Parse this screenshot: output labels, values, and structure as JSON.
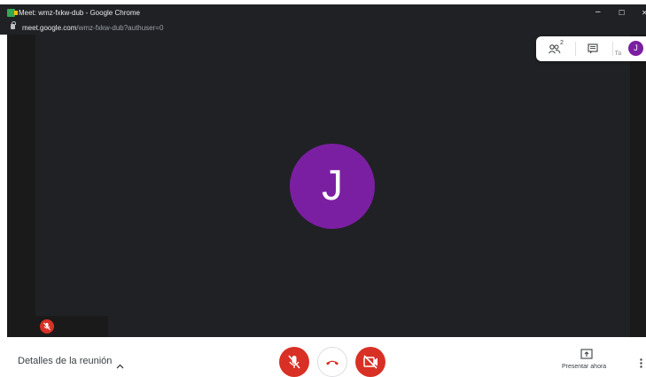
{
  "window": {
    "title": "Meet: wmz-fxkw-dub - Google Chrome",
    "minimize": "–",
    "maximize": "☐",
    "close": "✕"
  },
  "urlbar": {
    "host": "meet.google.com",
    "path": "/wmz-fxkw-dub?authuser=0"
  },
  "stage": {
    "participant_initial": "J",
    "avatar_color": "#7b1fa2"
  },
  "top_panel": {
    "people_count": "2",
    "self_initial": "J",
    "self_label": "Tú"
  },
  "bottom_bar": {
    "details_label": "Detalles de la reunión",
    "present_label": "Presentar ahora",
    "accent_red": "#d93025"
  }
}
